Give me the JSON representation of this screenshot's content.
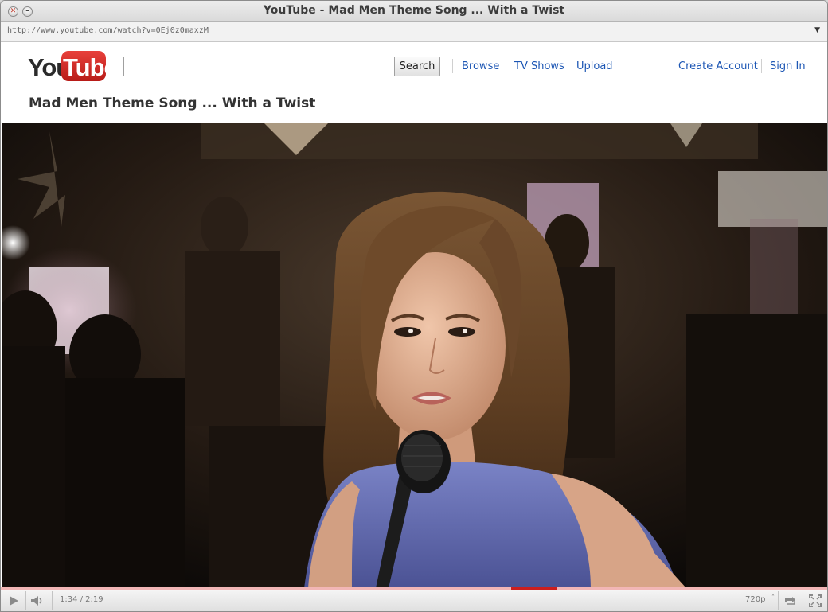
{
  "window": {
    "title": "YouTube - Mad Men Theme Song ... With a Twist",
    "url": "http://www.youtube.com/watch?v=0Ej0z0maxzM"
  },
  "header": {
    "logo_you": "You",
    "logo_tube": "Tube",
    "search": {
      "value": "",
      "placeholder": "",
      "button_label": "Search"
    },
    "nav": [
      "Browse",
      "TV Shows",
      "Upload"
    ],
    "account": [
      "Create Account",
      "Sign In"
    ]
  },
  "video": {
    "title": "Mad Men Theme Song ... With a Twist"
  },
  "player": {
    "time": "1:34 / 2:19",
    "quality": "720p",
    "played_fraction": 0.672,
    "buffered_fraction": 1.0
  },
  "icons": {
    "close": "close-icon",
    "minimize": "minimize-icon",
    "play": "play-icon",
    "volume": "volume-icon",
    "quality": "quality-icon",
    "popout": "popout-icon",
    "fullscreen": "fullscreen-icon"
  },
  "colors": {
    "brand_red": "#cc1e1e",
    "link_blue": "#1c56b4",
    "dress_blue": "#6a73b8"
  }
}
